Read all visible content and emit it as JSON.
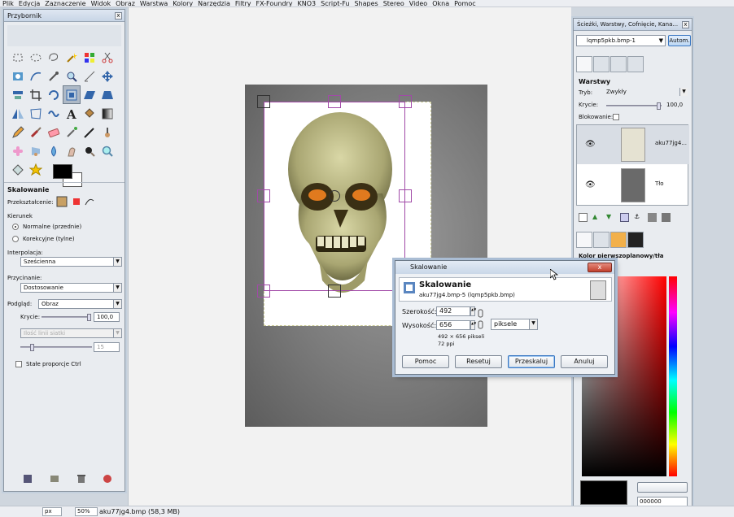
{
  "menubar": [
    "Plik",
    "Edycja",
    "Zaznaczenie",
    "Widok",
    "Obraz",
    "Warstwa",
    "Kolory",
    "Narzędzia",
    "Filtry",
    "FX-Foundry",
    "KNO3",
    "Script-Fu",
    "Shapes",
    "Stereo",
    "Video",
    "Okna",
    "Pomoc"
  ],
  "toolbox": {
    "title": "Przybornik",
    "close": "x",
    "tools": [
      "rect-select-icon",
      "ellipse-select-icon",
      "lasso-icon",
      "fuzzy-select-icon",
      "color-select-icon",
      "scissors-icon",
      "foreground-select-icon",
      "paths-icon",
      "color-picker-icon",
      "zoom-icon",
      "measure-icon",
      "move-icon",
      "align-icon",
      "crop-icon",
      "rotate-icon",
      "scale-icon",
      "shear-icon",
      "perspective-icon",
      "flip-icon",
      "cage-icon",
      "warp-icon",
      "text-icon",
      "bucket-fill-icon",
      "blend-icon",
      "pencil-icon",
      "paintbrush-icon",
      "eraser-icon",
      "airbrush-icon",
      "ink-icon",
      "clone-icon",
      "heal-icon",
      "perspective-clone-icon",
      "blur-icon",
      "smudge-icon",
      "dodge-burn-icon",
      "magnify-icon",
      "color-balance-icon",
      "star-icon"
    ],
    "options": {
      "title": "Skalowanie",
      "transform_label": "Przekształcenie:",
      "direction_label": "Kierunek",
      "direction_normal": "Normalne (przednie)",
      "direction_corrective": "Korekcyjne (tylne)",
      "interpolation_label": "Interpolacja:",
      "interpolation_value": "Sześcienna",
      "clipping_label": "Przycinanie:",
      "clipping_value": "Dostosowanie",
      "preview_label": "Podgląd:",
      "preview_value": "Obraz",
      "opacity_label": "Krycie:",
      "opacity_value": "100,0",
      "grid_combo": "Ilość linii siatki",
      "grid_value": "15",
      "keep_aspect": "Stałe proporcje  Ctrl"
    }
  },
  "dock": {
    "title": "Ścieżki, Warstwy, Cofnięcie, Kana...",
    "image_combo": "lqmp5pkb.bmp-1",
    "auto_button": "Autom.",
    "layers": {
      "title": "Warstwy",
      "mode_label": "Tryb:",
      "mode_value": "Zwykły",
      "opacity_label": "Krycie:",
      "opacity_value": "100,0",
      "lock_label": "Blokowanie:",
      "items": [
        {
          "name": "aku77jg4..."
        },
        {
          "name": "Tło"
        }
      ]
    },
    "colors": {
      "title": "Kolor pierwszoplanowy/tła",
      "hex": "000000"
    }
  },
  "dialog": {
    "title": "Skalowanie",
    "heading": "Skalowanie",
    "subheading": "aku77jg4.bmp-5 (lqmp5pkb.bmp)",
    "width_label": "Szerokość:",
    "width_value": "492",
    "height_label": "Wysokość:",
    "height_value": "656",
    "unit": "piksele",
    "size_info": "492 × 656 pikseli",
    "dpi_info": "72 ppi",
    "buttons": {
      "help": "Pomoc",
      "reset": "Resetuj",
      "scale": "Przeskaluj",
      "cancel": "Anuluj"
    }
  },
  "statusbar": {
    "unit": "px",
    "zoom": "50%",
    "file": "aku77jg4.bmp (58,3 MB)"
  }
}
